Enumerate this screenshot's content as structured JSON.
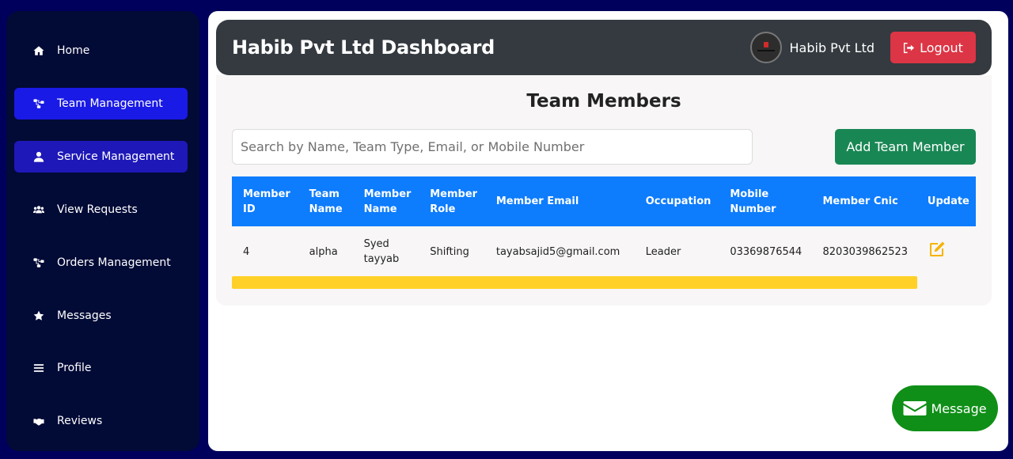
{
  "sidebar": {
    "items": [
      {
        "label": "Home",
        "icon": "home-icon"
      },
      {
        "label": "Team Management",
        "icon": "sitemap-icon"
      },
      {
        "label": "Service Management",
        "icon": "user-icon"
      },
      {
        "label": "View Requests",
        "icon": "users-icon"
      },
      {
        "label": "Orders Management",
        "icon": "sitemap-icon"
      },
      {
        "label": "Messages",
        "icon": "star-icon"
      },
      {
        "label": "Profile",
        "icon": "bars-icon"
      },
      {
        "label": "Reviews",
        "icon": "handshake-icon"
      }
    ]
  },
  "header": {
    "title": "Habib Pvt Ltd Dashboard",
    "company_name": "Habib Pvt Ltd",
    "logout_label": "Logout"
  },
  "main": {
    "section_title": "Team Members",
    "search_placeholder": "Search by Name, Team Type, Email, or Mobile Number",
    "add_button_label": "Add Team Member",
    "table": {
      "headers": [
        "Member ID",
        "Team Name",
        "Member Name",
        "Member Role",
        "Member Email",
        "Occupation",
        "Mobile Number",
        "Member Cnic",
        "Update"
      ],
      "rows": [
        [
          "4",
          "alpha",
          "Syed tayyab",
          "Shifting",
          "tayabsajid5@gmail.com",
          "Leader",
          "03369876544",
          "8203039862523"
        ]
      ]
    }
  },
  "message_button_label": "Message",
  "colors": {
    "background": "#00005c",
    "sidebar": "#020a36",
    "active_nav": "#1a1ae6",
    "header": "#343a40",
    "logout": "#dc3545",
    "add_button": "#198754",
    "table_header": "#0d7cfd",
    "scroll_bar": "#ffd028",
    "message_button": "#0f8f17"
  }
}
